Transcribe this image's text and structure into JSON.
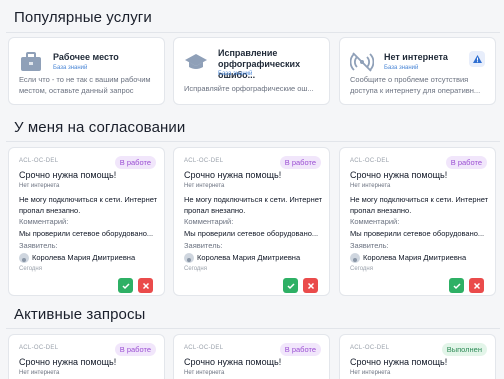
{
  "sections": {
    "popular": "Популярные услуги",
    "approvals": "У меня на согласовании",
    "active": "Активные запросы"
  },
  "services": [
    {
      "title": "Рабочее место",
      "kb": "База знаний",
      "desc": "Если что - то не так с вашим рабочим местом, оставьте данный запрос"
    },
    {
      "title_line1": "Исправление",
      "title_line2": "орфографических ошибо...",
      "kb": "База знаний",
      "desc": "Исправляйте орфографические ош..."
    },
    {
      "title": "Нет интернета",
      "kb": "База знаний",
      "desc": "Сообщите о проблеме отсутствия доступа к интернету для оперативн..."
    }
  ],
  "approvals": [
    {
      "id": "ACL-OC-DEL",
      "status": "В работе",
      "title": "Срочно нужна помощь!",
      "sub": "Нет интернета",
      "body": "Не могу подключиться к сети. Интернет пропал внезапно.",
      "comment_label": "Комментарий:",
      "comment": "Мы проверили сетевое оборудовано...",
      "applicant_label": "Заявитель:",
      "applicant": "Королева Мария Дмитриевна",
      "date": "Сегодня"
    },
    {
      "id": "ACL-OC-DEL",
      "status": "В работе",
      "title": "Срочно нужна помощь!",
      "sub": "Нет интернета",
      "body": "Не могу подключиться к сети. Интернет пропал внезапно.",
      "comment_label": "Комментарий:",
      "comment": "Мы проверили сетевое оборудовано...",
      "applicant_label": "Заявитель:",
      "applicant": "Королева Мария Дмитриевна",
      "date": "Сегодня"
    },
    {
      "id": "ACL-OC-DEL",
      "status": "В работе",
      "title": "Срочно нужна помощь!",
      "sub": "Нет интернета",
      "body": "Не могу подключиться к сети. Интернет пропал внезапно.",
      "comment_label": "Комментарий:",
      "comment": "Мы проверили сетевое оборудовано...",
      "applicant_label": "Заявитель:",
      "applicant": "Королева Мария Дмитриевна",
      "date": "Сегодня"
    }
  ],
  "active": [
    {
      "id": "ACL-OC-DEL",
      "status": "В работе",
      "title": "Срочно нужна помощь!",
      "sub": "Нет интернета"
    },
    {
      "id": "ACL-OC-DEL",
      "status": "В работе",
      "title": "Срочно нужна помощь!",
      "sub": "Нет интернета"
    },
    {
      "id": "ACL-OC-DEL",
      "status": "Выполнен",
      "title": "Срочно нужна помощь!",
      "sub": "Нет интернета"
    }
  ],
  "icons": {
    "workplace": "briefcase-icon",
    "spelling": "graduation-cap-icon",
    "internet": "no-signal-icon",
    "warning": "warning-icon",
    "approve": "check-icon",
    "reject": "close-icon"
  },
  "colors": {
    "accent": "#4a86d6",
    "approve": "#2eb065",
    "reject": "#ea4b4b",
    "in_progress_bg": "#f1e6fb",
    "in_progress_text": "#9b4fd3",
    "done_bg": "#e3f5e9",
    "done_text": "#2e8b57"
  }
}
